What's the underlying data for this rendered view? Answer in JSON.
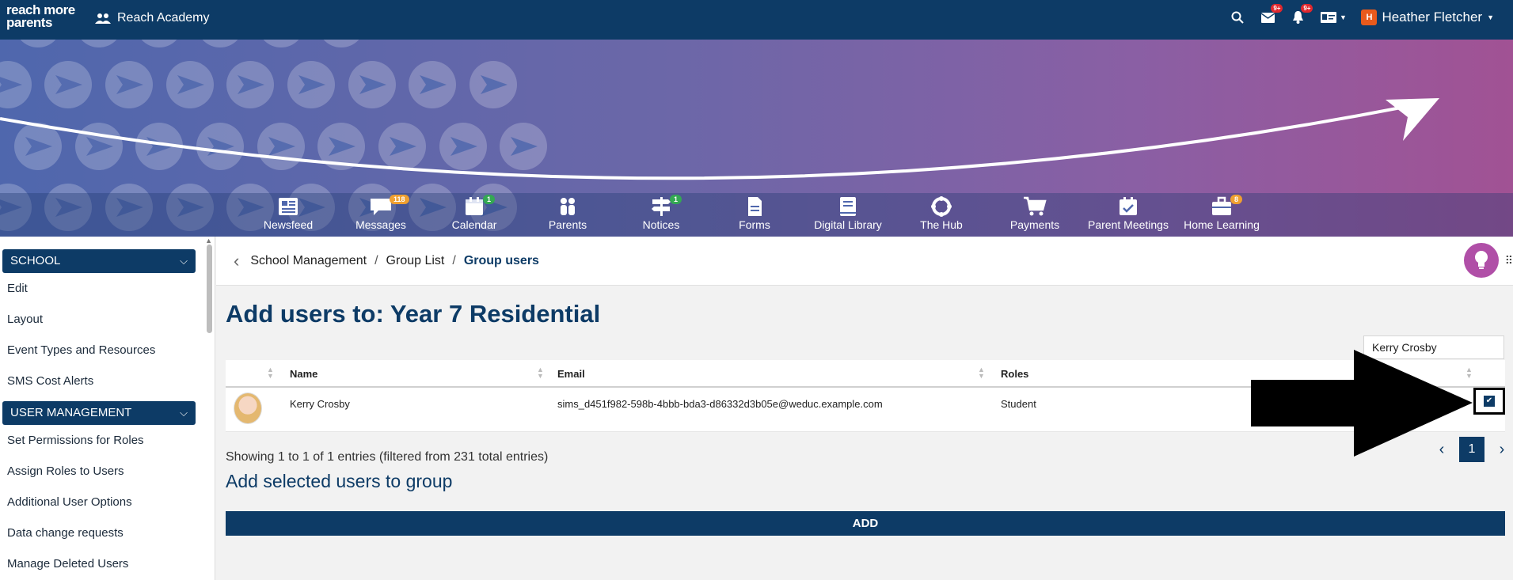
{
  "topbar": {
    "logo_line1": "reach more",
    "logo_line2": "parents",
    "school_name": "Reach Academy",
    "messages_badge": "9+",
    "notifications_badge": "9+",
    "user_initial": "H",
    "user_name": "Heather Fletcher"
  },
  "nav": [
    {
      "label": "Newsfeed",
      "icon": "newsfeed-icon",
      "badge": ""
    },
    {
      "label": "Messages",
      "icon": "messages-icon",
      "badge": "118"
    },
    {
      "label": "Calendar",
      "icon": "calendar-icon",
      "badge": "1"
    },
    {
      "label": "Parents",
      "icon": "parents-icon",
      "badge": ""
    },
    {
      "label": "Notices",
      "icon": "notices-icon",
      "badge": "1"
    },
    {
      "label": "Forms",
      "icon": "forms-icon",
      "badge": ""
    },
    {
      "label": "Digital Library",
      "icon": "library-icon",
      "badge": ""
    },
    {
      "label": "The Hub",
      "icon": "hub-icon",
      "badge": ""
    },
    {
      "label": "Payments",
      "icon": "cart-icon",
      "badge": ""
    },
    {
      "label": "Parent Meetings",
      "icon": "meetings-icon",
      "badge": ""
    },
    {
      "label": "Home Learning",
      "icon": "briefcase-icon",
      "badge": "8"
    }
  ],
  "sidebar": {
    "section1": {
      "title": "SCHOOL",
      "items": [
        "Edit",
        "Layout",
        "Event Types and Resources",
        "SMS Cost Alerts"
      ]
    },
    "section2": {
      "title": "USER MANAGEMENT",
      "items": [
        "Set Permissions for Roles",
        "Assign Roles to Users",
        "Additional User Options",
        "Data change requests",
        "Manage Deleted Users"
      ]
    }
  },
  "breadcrumb": {
    "items": [
      "School Management",
      "Group List"
    ],
    "separator": "/",
    "current": "Group users"
  },
  "page": {
    "title": "Add users to: Year 7 Residential",
    "search_value": "Kerry Crosby"
  },
  "table": {
    "headers": [
      "Name",
      "Email",
      "Roles"
    ],
    "rows": [
      {
        "name": "Kerry Crosby",
        "email": "sims_d451f982-598b-4bbb-bda3-d86332d3b05e@weduc.example.com",
        "role": "Student",
        "checked": true
      }
    ]
  },
  "entries_info": "Showing 1 to 1 of 1 entries (filtered from 231 total entries)",
  "pagination": {
    "current_page": "1"
  },
  "add_section": {
    "title": "Add selected users to group",
    "button_label": "ADD"
  },
  "colors": {
    "primary": "#0d3b66",
    "accent": "#b04fa7",
    "badge_red": "#e0282e",
    "badge_orange": "#f0a030",
    "badge_green": "#34a853"
  }
}
